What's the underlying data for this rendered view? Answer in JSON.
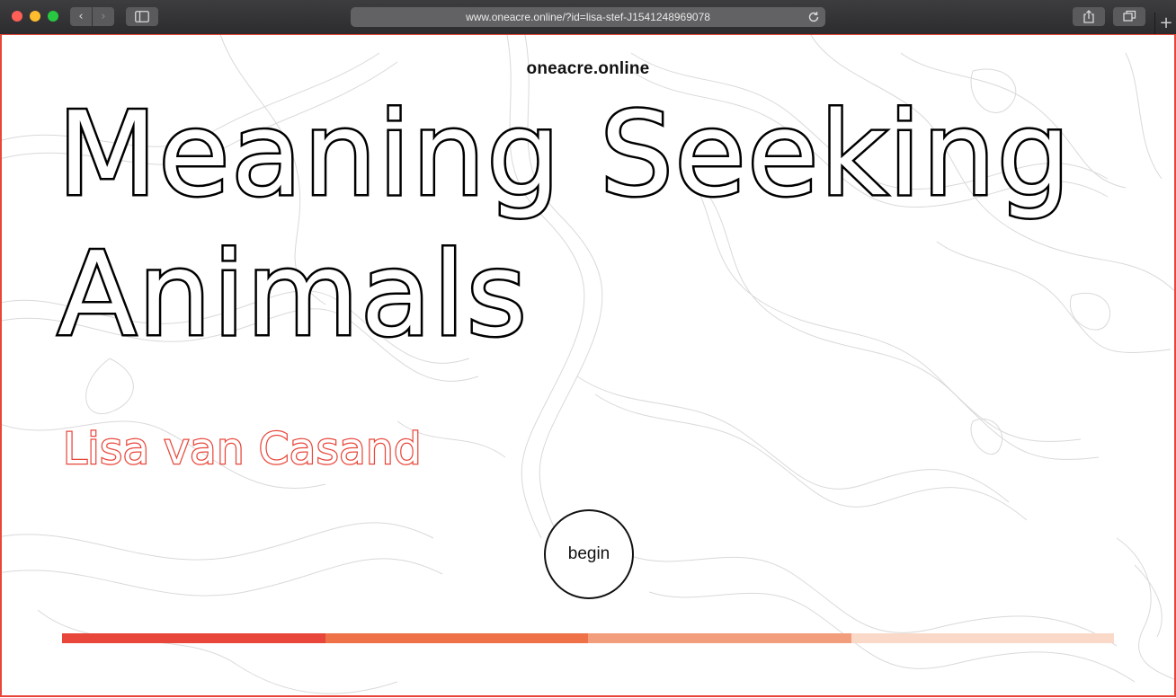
{
  "browser": {
    "url": "www.oneacre.online/?id=lisa-stef-J1541248969078",
    "back_icon": "‹",
    "forward_icon": "›",
    "new_tab_icon": "+"
  },
  "page": {
    "site_name": "oneacre.online",
    "title_line_1": "Meaning Seeking",
    "title_line_2": "Animals",
    "author": "Lisa van Casand",
    "begin_label": "begin",
    "progress_colors": [
      "#e8463a",
      "#ee7148",
      "#f29d7c",
      "#fad9c8"
    ]
  }
}
